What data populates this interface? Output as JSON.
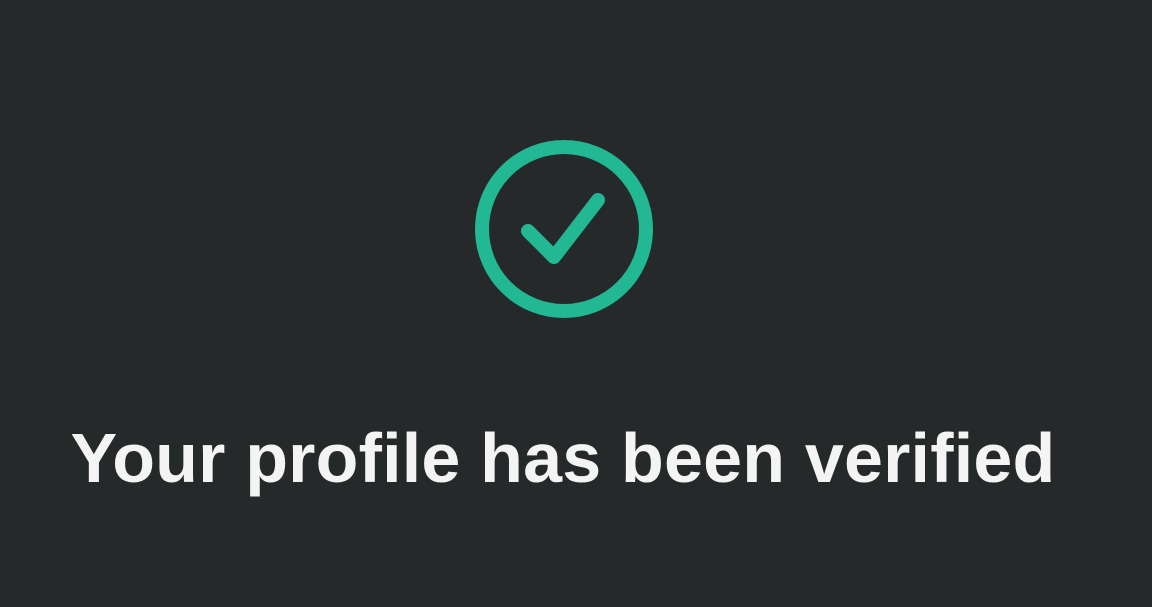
{
  "verification": {
    "status_icon": "check-circle-icon",
    "message": "Your profile has been verified"
  },
  "colors": {
    "background": "#25292a",
    "accent": "#22b894",
    "text": "#f4f4f4"
  }
}
